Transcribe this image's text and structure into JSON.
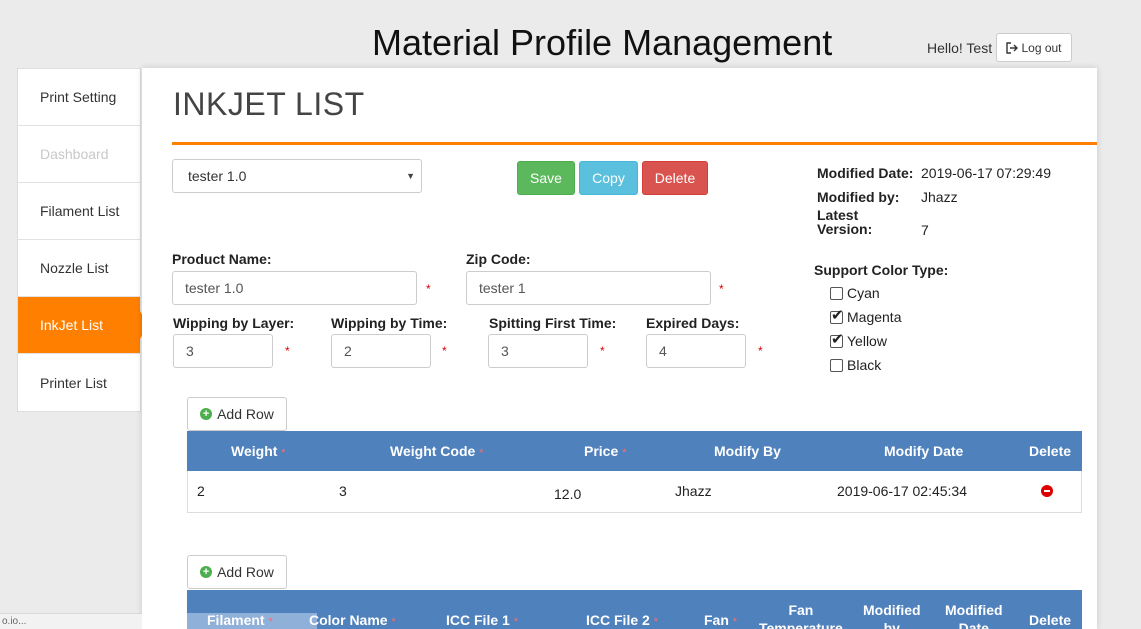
{
  "app": {
    "title": "Material Profile Management",
    "greeting": "Hello! Test",
    "logout_label": "Log out"
  },
  "sidebar": {
    "items": [
      {
        "label": "Print Setting",
        "state": "normal"
      },
      {
        "label": "Dashboard",
        "state": "disabled"
      },
      {
        "label": "Filament List",
        "state": "normal"
      },
      {
        "label": "Nozzle List",
        "state": "normal"
      },
      {
        "label": "InkJet List",
        "state": "active"
      },
      {
        "label": "Printer List",
        "state": "normal"
      }
    ]
  },
  "page": {
    "title": "INKJET LIST",
    "selected_profile": "tester 1.0",
    "buttons": {
      "save": "Save",
      "copy": "Copy",
      "delete": "Delete"
    },
    "meta": {
      "modified_date_label": "Modified Date:",
      "modified_date": "2019-06-17 07:29:49",
      "modified_by_label": "Modified by:",
      "modified_by": "Jhazz",
      "latest_version_label_1": "Latest",
      "latest_version_label_2": "Version:",
      "latest_version": "7"
    },
    "fields": {
      "product_name_label": "Product Name:",
      "product_name": "tester 1.0",
      "zip_code_label": "Zip Code:",
      "zip_code": "tester 1",
      "wipping_layer_label": "Wipping by Layer:",
      "wipping_layer": "3",
      "wipping_time_label": "Wipping by Time:",
      "wipping_time": "2",
      "spitting_label": "Spitting First Time:",
      "spitting": "3",
      "expired_label": "Expired Days:",
      "expired": "4",
      "required_mark": "*"
    },
    "color_type": {
      "label": "Support Color Type:",
      "options": [
        {
          "label": "Cyan",
          "checked": false
        },
        {
          "label": "Magenta",
          "checked": true
        },
        {
          "label": "Yellow",
          "checked": true
        },
        {
          "label": "Black",
          "checked": false
        }
      ]
    },
    "add_row_label": "Add Row",
    "table1": {
      "headers": [
        "Weight",
        "Weight Code",
        "Price",
        "Modify By",
        "Modify Date",
        "Delete"
      ],
      "required_mark": "*",
      "rows": [
        {
          "weight": "2",
          "weight_code": "3",
          "price": "12.0",
          "modify_by": "Jhazz",
          "modify_date": "2019-06-17 02:45:34"
        }
      ]
    },
    "table2": {
      "headers": [
        "Filament",
        "Color Name",
        "ICC File 1",
        "ICC File 2",
        "Fan",
        "Fan",
        "Temperature",
        "Modified",
        "by",
        "Modified",
        "Date",
        "Delete"
      ],
      "required_mark": "*"
    }
  },
  "status_bar": {
    "text": "o.io..."
  },
  "colors": {
    "accent": "#ff7f00",
    "table_header": "#4f81bd",
    "save": "#5cb85c",
    "copy": "#5bc0de",
    "delete": "#d9534f"
  }
}
